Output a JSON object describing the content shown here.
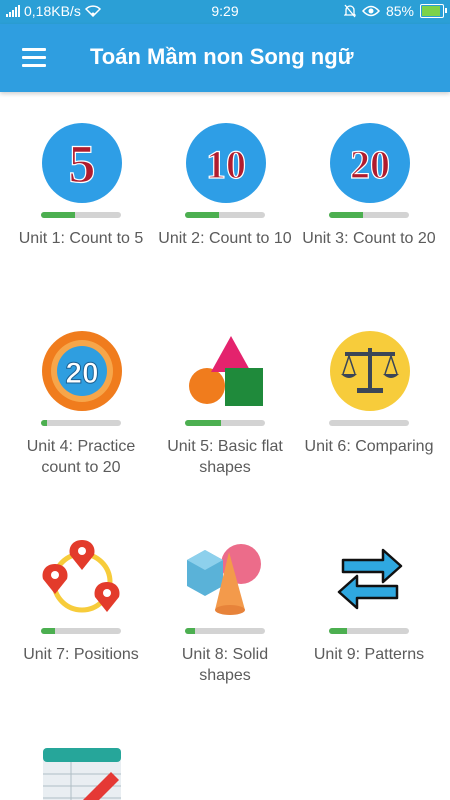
{
  "status_bar": {
    "network_speed": "0,18KB/s",
    "time": "9:29",
    "battery": "85%",
    "icons": [
      "signal-icon",
      "wifi-icon",
      "bell-muted-icon",
      "eye-icon",
      "battery-icon"
    ]
  },
  "app_bar": {
    "title": "Toán Mầm non Song ngữ",
    "menu_icon": "hamburger-icon"
  },
  "units": [
    {
      "label": "Unit 1: Count to 5",
      "icon": "number-5-icon",
      "progress": 0.42
    },
    {
      "label": "Unit 2: Count to 10",
      "icon": "number-10-icon",
      "progress": 0.42
    },
    {
      "label": "Unit 3: Count to 20",
      "icon": "number-20-icon",
      "progress": 0.42
    },
    {
      "label": "Unit 4: Practice count to 20",
      "icon": "practice-20-icon",
      "progress": 0.08
    },
    {
      "label": "Unit 5: Basic flat shapes",
      "icon": "flat-shapes-icon",
      "progress": 0.45
    },
    {
      "label": "Unit 6: Comparing",
      "icon": "balance-scale-icon",
      "progress": 0.0
    },
    {
      "label": "Unit 7: Positions",
      "icon": "location-pins-icon",
      "progress": 0.18
    },
    {
      "label": "Unit 8: Solid shapes",
      "icon": "solid-shapes-icon",
      "progress": 0.12
    },
    {
      "label": "Unit 9: Patterns",
      "icon": "repeat-arrows-icon",
      "progress": 0.22
    },
    {
      "label": "",
      "icon": "spreadsheet-pencil-icon",
      "progress": 0.0
    }
  ],
  "colors": {
    "appbar": "#2f9ee0",
    "statusbar": "#2b9fd6",
    "progress_fill": "#4caf50",
    "progress_track": "#d3d3d3",
    "label_text": "#5b5b5b"
  }
}
